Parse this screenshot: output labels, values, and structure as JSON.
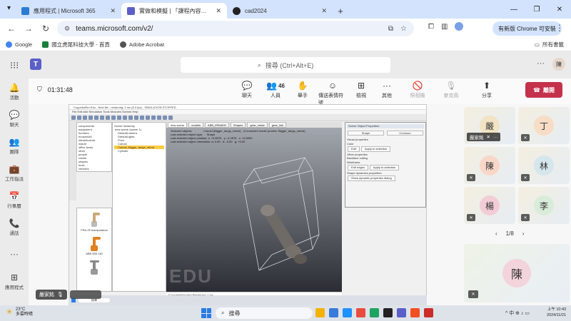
{
  "browser": {
    "tabs": [
      {
        "title": "應用程式 | Microsoft 365",
        "color": "#2b7cd3",
        "active": false
      },
      {
        "title": "實做和模擬 | 「課程內容討論」中的會議",
        "color": "#5b5fc7",
        "active": true
      },
      {
        "title": "cad2024",
        "color": "#222222",
        "active": false
      }
    ],
    "new_tab_label": "+",
    "url": "teams.microsoft.com/v2/",
    "profile_label": "有新版 Chrome 可安裝",
    "bookmarks": [
      {
        "label": "Google",
        "color": "#4285f4"
      },
      {
        "label": "國立虎尾科技大學 - 首頁",
        "color": "#1b7f3b"
      },
      {
        "label": "Adobe Acrobat",
        "color": "#555555"
      }
    ],
    "all_bookmarks": "所有書籤"
  },
  "teams": {
    "search_placeholder": "搜尋 (Ctrl+Alt+E)",
    "avatar_initial": "陳",
    "rail": [
      {
        "icon": "🔔",
        "label": "活動"
      },
      {
        "icon": "💬",
        "label": "聊天"
      },
      {
        "icon": "👥",
        "label": "團隊"
      },
      {
        "icon": "💼",
        "label": "工作指派"
      },
      {
        "icon": "📅",
        "label": "行事曆"
      },
      {
        "icon": "📞",
        "label": "通話"
      },
      {
        "icon": "···",
        "label": ""
      },
      {
        "icon": "⊞",
        "label": "應用程式"
      }
    ]
  },
  "meeting": {
    "timer": "01:31:48",
    "tools": [
      {
        "icon": "💬",
        "label": "聊天",
        "badge": ""
      },
      {
        "icon": "👥",
        "label": "人員",
        "badge": "46"
      },
      {
        "icon": "✋",
        "label": "舉手",
        "badge": ""
      },
      {
        "icon": "☺",
        "label": "傳送表情符號",
        "badge": ""
      },
      {
        "icon": "⊞",
        "label": "檢視",
        "badge": ""
      },
      {
        "icon": "···",
        "label": "其他",
        "badge": ""
      },
      {
        "icon": "🚫",
        "label": "照相機",
        "badge": ""
      },
      {
        "icon": "🎙",
        "label": "麥克風",
        "badge": ""
      },
      {
        "icon": "⬆",
        "label": "分享",
        "badge": ""
      }
    ],
    "leave_label": "離開",
    "presenter_name": "嚴家銘",
    "pager": "1/8",
    "participants": [
      {
        "initial": "嚴",
        "color": "#f1e3c4",
        "name": "嚴家銘"
      },
      {
        "initial": "丁",
        "color": "#f7dcc6",
        "name": ""
      },
      {
        "initial": "陳",
        "color": "#f8d7c9",
        "name": ""
      },
      {
        "initial": "林",
        "color": "#d5e6ec",
        "name": ""
      },
      {
        "initial": "楊",
        "color": "#f3cdd6",
        "name": ""
      },
      {
        "initial": "李",
        "color": "#d8ecd9",
        "name": ""
      }
    ],
    "self_initial": "陳"
  },
  "shared_screen": {
    "app_title": "CoppeliaSim Edu - New file - rendering: 2 ms (8.0 fps) - SIMULATION STOPPED",
    "menu": "File   Edit   Add   Simulation   Tools   Modules   Scenes   Help",
    "tree_items": [
      "components",
      "equipment",
      "furniture",
      "household",
      "infrastructure",
      "nature",
      "office items",
      "other",
      "people",
      "robots",
      "shapes",
      "tools",
      "vehicles",
      "mobile",
      "non-mobile",
      "Models"
    ],
    "parts_items": [
      "FRA.ZF.manipulators",
      "ABB IRB 140",
      "IRB4600",
      "ABB IRB 4600"
    ],
    "model_title": "Scene hierarchy",
    "model_items": [
      "new scene (scene 1)",
      "DefaultCamera",
      "DefaultLights",
      "Floor",
      "Cuboid",
      "Cuboid_Bigger_tangs_robrot",
      "Cylinder"
    ],
    "viewport_tabs": [
      "new scene",
      "models",
      "ABB_IRB4600",
      "Shapes",
      "gear_rotate",
      "gear_link"
    ],
    "viewport_text": "Selected objects:              Cuboid (Bigger_tangs_robrot)   (Connected model proxies: Bigger_tangs_robrot)\nLast selected object type:     Shape\nLast selected object position: x: +0.8975   y: -0.2575   z: +0.6000\nLast selected object orientation: a: 0.00   b: -0.00   g: +0.00",
    "watermark": "EDU",
    "props_title": "Scene Object Properties",
    "props_tabs": [
      "Shape",
      "Common"
    ],
    "props_lines": [
      "Visual properties",
      "Color",
      "Edit",
      "Apply to selection",
      "Other properties",
      "Backface culling",
      "Wireframe",
      "Edit edges",
      "Apply to selection",
      "Shape dynamics properties",
      "Show dynamic properties dialog"
    ],
    "log_lines": [
      "[CoppeliaSim:info]  Rendering: 2 ms",
      "[CoppeliaSim:info]  Done.",
      "Input Lua code here, or type \"help()\" (use TAB for auto-completion)"
    ],
    "taskbar_search": "搜尋"
  },
  "taskbar": {
    "weather_temp": "23°C",
    "weather_desc": "多雲時晴",
    "search_label": "搜尋",
    "apps": [
      "#f5b301",
      "#3a7ad9",
      "#1e90ff",
      "#e84c3d",
      "#1da462",
      "#222222",
      "#5b5fc7",
      "#f25022",
      "#cc2b2b"
    ],
    "tray": "^  中  ⊕  ♪  ▭",
    "time": "上午 10:43",
    "date": "2024/11/21"
  }
}
